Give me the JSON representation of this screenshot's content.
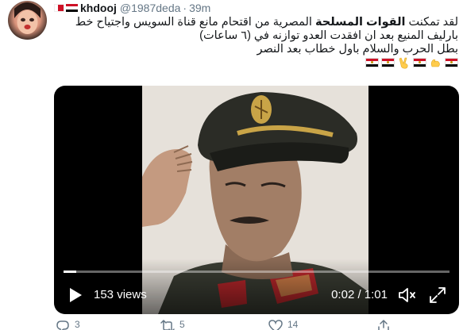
{
  "tweet": {
    "author": {
      "name": "khdooj",
      "handle": "@1987deda",
      "separator": "·",
      "time": "39m"
    },
    "text": {
      "line1_pre": "لقد تمكنت ",
      "line1_bold": "القوات المسلحة",
      "line1_post": " المصرية من اقتحام مانع قناة السويس واجتياح خط",
      "line2": "بارليف المنيع بعد ان افقدت العدو توازنه في (٦ ساعات)",
      "line3": "بطل الحرب والسلام باول خطاب بعد النصر"
    },
    "emojis": [
      "egypt-flag",
      "flexed-biceps",
      "egypt-flag",
      "victory-hand",
      "egypt-flag",
      "egypt-flag"
    ],
    "video": {
      "views": "153 views",
      "timecode": "0:02 / 1:01",
      "progress": 0.033
    },
    "actions": {
      "replies": "3",
      "retweets": "5",
      "likes": "14"
    }
  },
  "colors": {
    "text": "#14171a",
    "secondary": "#657786",
    "egypt_red": "#ce1126",
    "egypt_black": "#000000"
  }
}
